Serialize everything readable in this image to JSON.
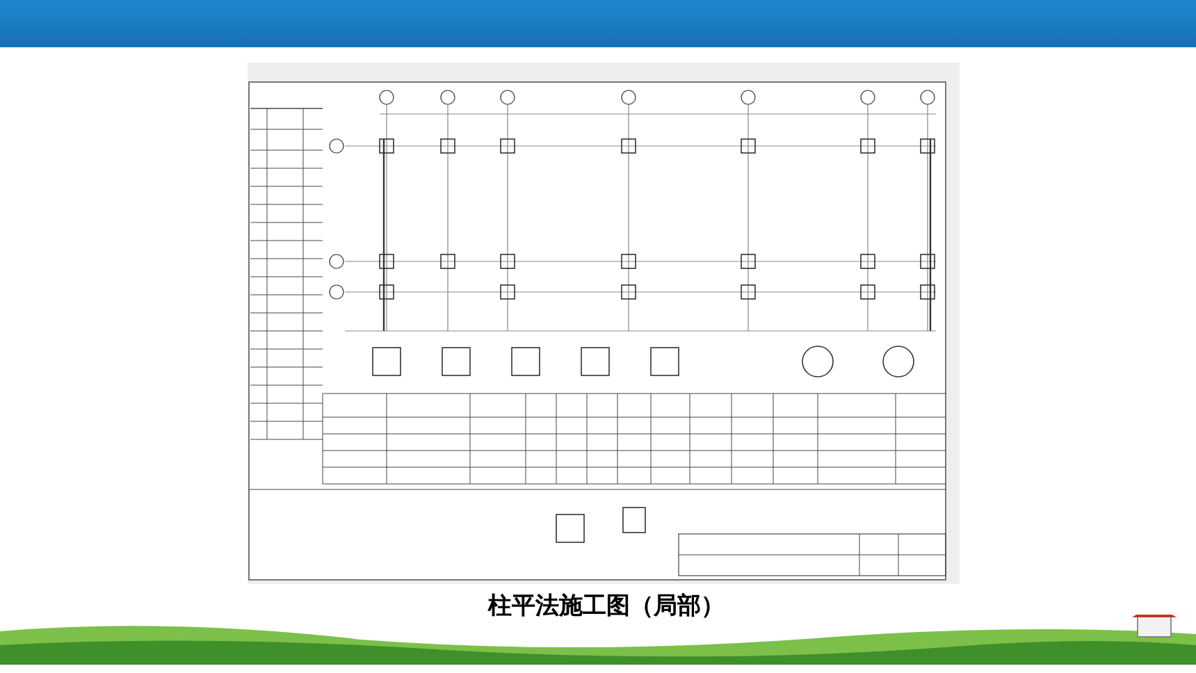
{
  "slide": {
    "caption": "柱平法施工图（局部）"
  }
}
